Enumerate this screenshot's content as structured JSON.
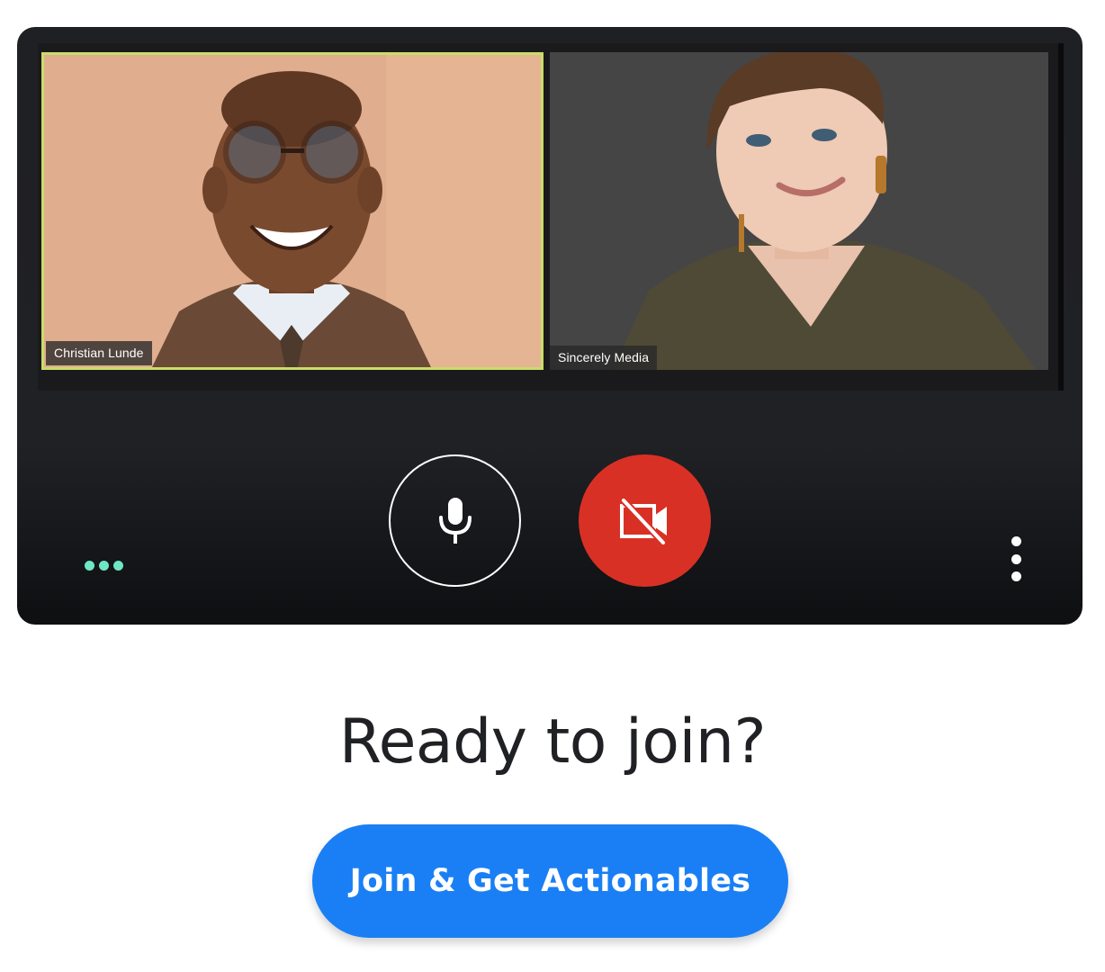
{
  "participants": [
    {
      "name": "Christian Lunde",
      "active_speaker": true
    },
    {
      "name": "Sincerely Media",
      "active_speaker": false
    }
  ],
  "controls": {
    "mic_icon": "microphone-icon",
    "camera_icon": "video-off-icon",
    "camera_off": true,
    "more_icon": "more-vert-icon",
    "status_icon": "typing-dots-icon"
  },
  "prompt": {
    "title": "Ready to join?",
    "join_label": "Join & Get Actionables"
  },
  "colors": {
    "accent_blue": "#1a7ff5",
    "camera_off_red": "#d93025",
    "active_speaker_border": "#c9dc6a",
    "status_dots": "#6fe6c6",
    "panel_bg": "#202125"
  }
}
